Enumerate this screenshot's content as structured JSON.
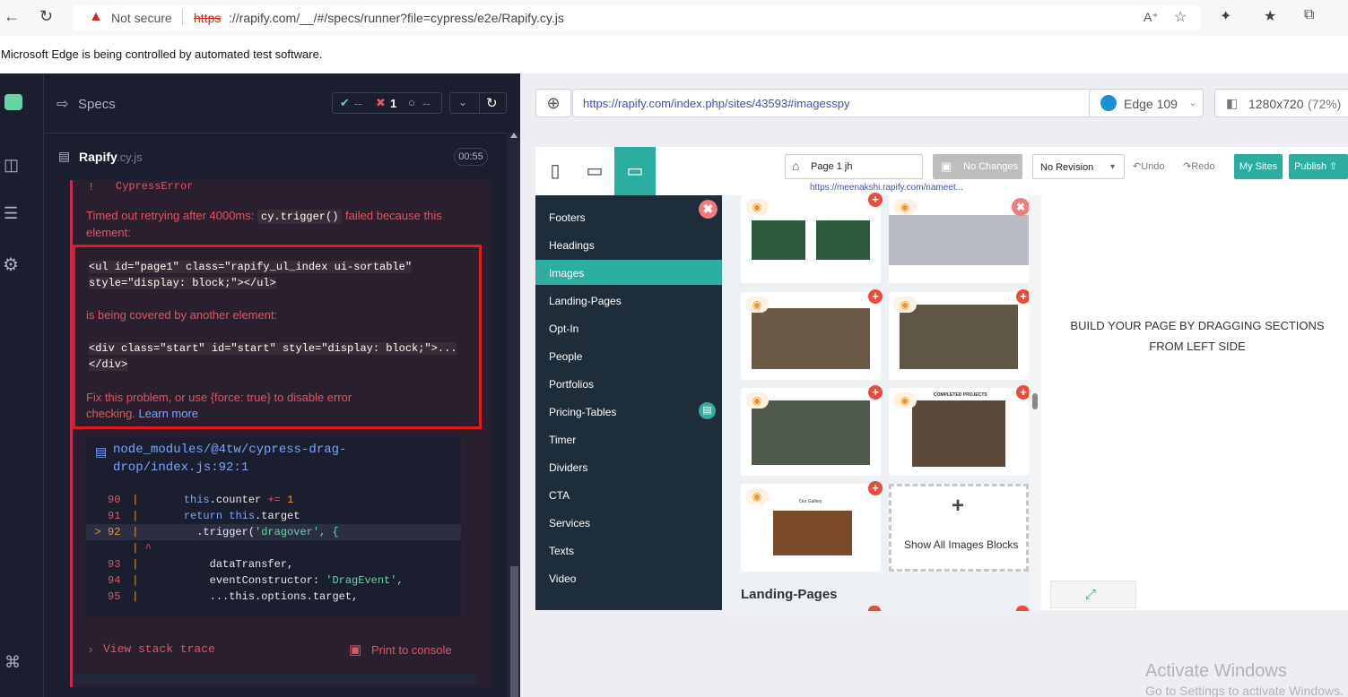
{
  "browser": {
    "not_secure": "Not secure",
    "url_scheme": "https",
    "url_rest": "://rapify.com/__/#/specs/runner?file=cypress/e2e/Rapify.cy.js",
    "banner": "Microsoft Edge is being controlled by automated test software."
  },
  "cypress": {
    "specs_label": "Specs",
    "pass_count": "--",
    "fail_count": "1",
    "pending_count": "--",
    "spec_file": "Rapify",
    "spec_ext": ".cy.js",
    "duration": "00:55",
    "error_type": "CypressError",
    "msg_part1": "Timed out retrying after 4000ms: ",
    "msg_code": "cy.trigger()",
    "msg_part2": " failed because this element:",
    "code1": "<ul id=\"page1\" class=\"rapify_ul_index ui-sortable\" style=\"display: block;\"></ul>",
    "covered": "is being covered by another element:",
    "code2": "<div class=\"start\" id=\"start\" style=\"display: block;\">...</div>",
    "fix_text": "Fix this problem, or use {force: true} to disable error checking. ",
    "learn_more": "Learn more",
    "file_link": "node_modules/@4tw/cypress-drag-drop/index.js:92:1",
    "code_lines": [
      {
        "num": "90",
        "pre": "      ",
        "kw": "this",
        "text": ".counter ",
        "op": "+= ",
        "lit": "1"
      },
      {
        "num": "91",
        "pre": "      ",
        "kw": "return this",
        "text": ".target",
        "op": "",
        "lit": ""
      },
      {
        "num": "92",
        "pre": "        ",
        "kw": "",
        "text": ".trigger(",
        "op": "",
        "lit": "'dragover', {"
      },
      {
        "num": "",
        "pre": "",
        "kw": "",
        "text": "^",
        "op": "",
        "lit": ""
      },
      {
        "num": "93",
        "pre": "          ",
        "kw": "",
        "text": "dataTransfer,",
        "op": "",
        "lit": ""
      },
      {
        "num": "94",
        "pre": "          ",
        "kw": "",
        "text": "eventConstructor: ",
        "op": "",
        "lit": "'DragEvent',"
      },
      {
        "num": "95",
        "pre": "          ",
        "kw": "",
        "text": "...this.options.target,",
        "op": "",
        "lit": ""
      }
    ],
    "view_stack": "View stack trace",
    "print_console": "Print to console"
  },
  "aut": {
    "url": "https://rapify.com/index.php/sites/43593#imagesspy",
    "browser": "Edge 109",
    "viewport": "1280x720",
    "scale": "(72%)"
  },
  "editor": {
    "page_name": "Page 1 jh",
    "no_changes": "No Changes",
    "revision": "No Revision",
    "undo": "Undo",
    "redo": "Redo",
    "my_sites": "My Sites",
    "publish": "Publish",
    "site_link": "https://meenakshi.rapify.com/nameet...",
    "categories": [
      "Footers",
      "Headings",
      "Images",
      "Landing-Pages",
      "Opt-In",
      "People",
      "Portfolios",
      "Pricing-Tables",
      "Timer",
      "Dividers",
      "CTA",
      "Services",
      "Texts",
      "Video"
    ],
    "active_category": "Images",
    "completed_projects": "COMPLETED PROJECTS",
    "our_gallery": "Our Gallery",
    "show_all": "Show All Images Blocks",
    "section_heading": "Landing-Pages",
    "build_text": "BUILD YOUR PAGE BY DRAGGING SECTIONS FROM LEFT SIDE"
  },
  "windows": {
    "activate": "Activate Windows",
    "goto": "Go to Settings to activate Windows."
  },
  "colors": {
    "accent_teal": "#2bada0",
    "error_red": "#e05561",
    "cypress_bg": "#1b1e2e",
    "sidebar": "#1e2d3a"
  }
}
